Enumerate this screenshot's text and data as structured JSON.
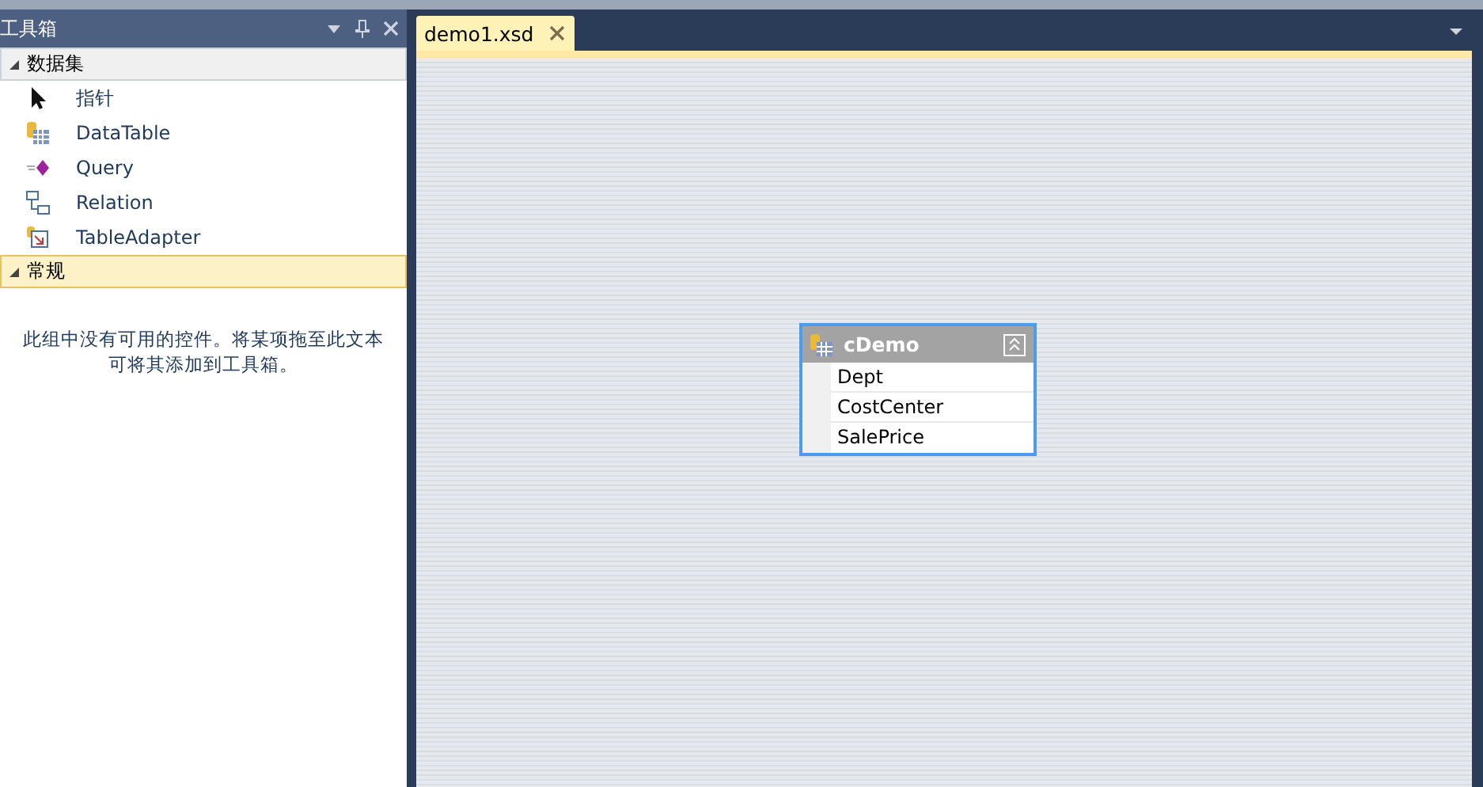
{
  "toolbox": {
    "title": "工具箱",
    "groups": [
      {
        "label": "数据集",
        "expanded": true,
        "selected": false,
        "items": [
          {
            "label": "指针",
            "kind": "pointer"
          },
          {
            "label": "DataTable",
            "kind": "datatable"
          },
          {
            "label": "Query",
            "kind": "query"
          },
          {
            "label": "Relation",
            "kind": "relation"
          },
          {
            "label": "TableAdapter",
            "kind": "adapter"
          }
        ]
      },
      {
        "label": "常规",
        "expanded": true,
        "selected": true,
        "empty_message": "此组中没有可用的控件。将某项拖至此文本可将其添加到工具箱。"
      }
    ]
  },
  "tabs": [
    {
      "label": "demo1.xsd",
      "selected": true
    }
  ],
  "designer": {
    "table": {
      "name": "cDemo",
      "columns": [
        "Dept",
        "CostCenter",
        "SalePrice"
      ]
    }
  }
}
